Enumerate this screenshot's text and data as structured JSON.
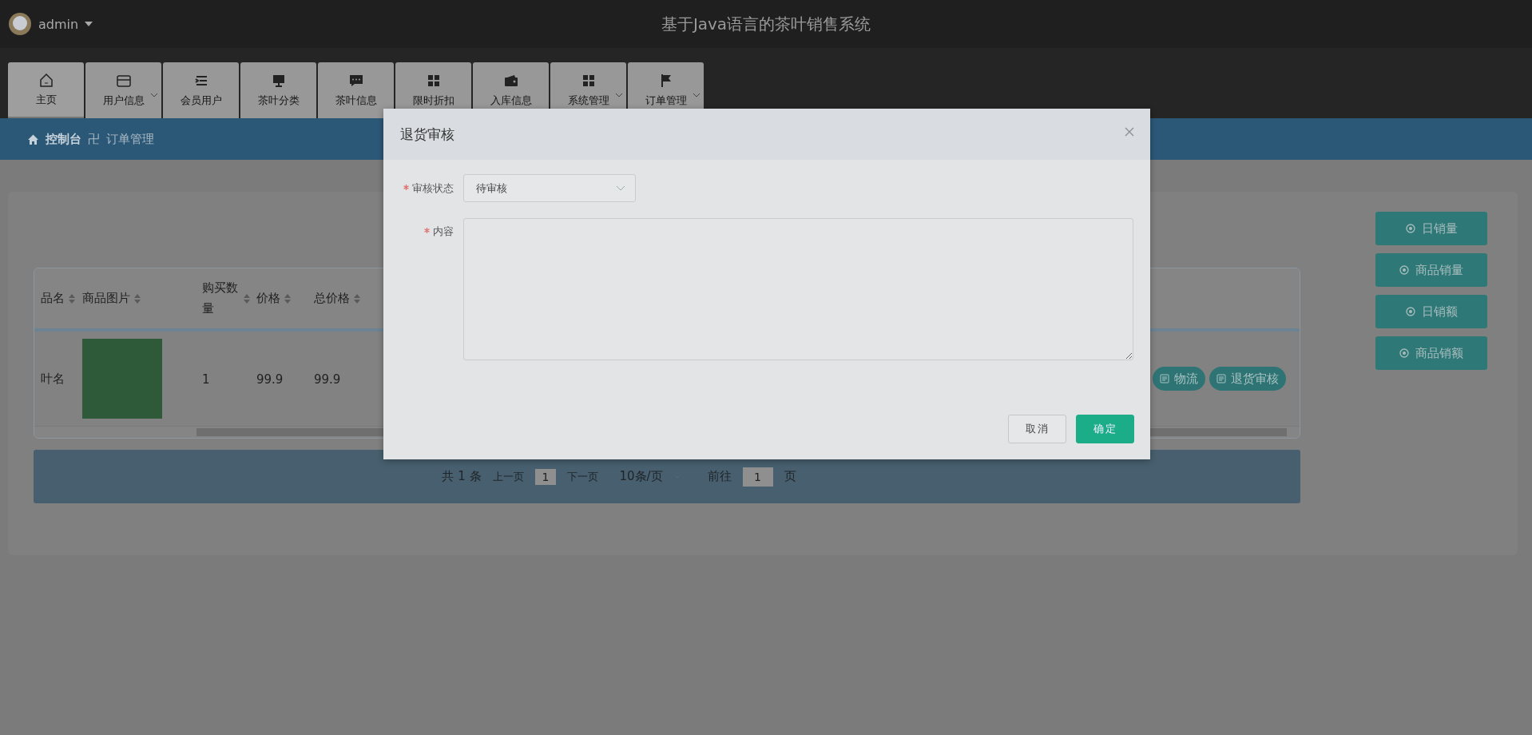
{
  "header": {
    "user": "admin",
    "title": "基于Java语言的茶叶销售系统"
  },
  "nav": [
    {
      "label": "主页",
      "has_dropdown": false,
      "selected": true
    },
    {
      "label": "用户信息",
      "has_dropdown": true,
      "selected": false
    },
    {
      "label": "会员用户",
      "has_dropdown": false,
      "selected": false
    },
    {
      "label": "茶叶分类",
      "has_dropdown": false,
      "selected": false
    },
    {
      "label": "茶叶信息",
      "has_dropdown": false,
      "selected": false
    },
    {
      "label": "限时折扣",
      "has_dropdown": false,
      "selected": false
    },
    {
      "label": "入库信息",
      "has_dropdown": false,
      "selected": false
    },
    {
      "label": "系统管理",
      "has_dropdown": true,
      "selected": false
    },
    {
      "label": "订单管理",
      "has_dropdown": true,
      "selected": false
    }
  ],
  "breadcrumb": {
    "home": "控制台",
    "separator": "卍",
    "current": "订单管理"
  },
  "table": {
    "columns": [
      "品名",
      "商品图片",
      "购买数量",
      "价格",
      "总价格"
    ],
    "rows": [
      {
        "cells": [
          "叶名",
          "",
          "1",
          "99.9",
          "99.9"
        ],
        "actions": [
          "物流",
          "退货审核"
        ]
      }
    ]
  },
  "pagination": {
    "total": "共 1 条",
    "prev": "上一页",
    "page": "1",
    "next": "下一页",
    "page_size": "10条/页",
    "goto": "前往",
    "goto_value": "1",
    "goto_suffix": "页"
  },
  "side_buttons": [
    "日销量",
    "商品销量",
    "日销额",
    "商品销额"
  ],
  "dialog": {
    "title": "退货审核",
    "fields": [
      {
        "label": "审核状态",
        "required": true,
        "kind": "select",
        "value": "待审核"
      },
      {
        "label": "内容",
        "required": true,
        "kind": "textarea"
      }
    ],
    "buttons": [
      {
        "label": "取消",
        "kind": "secondary"
      },
      {
        "label": "确定",
        "kind": "primary"
      }
    ]
  }
}
